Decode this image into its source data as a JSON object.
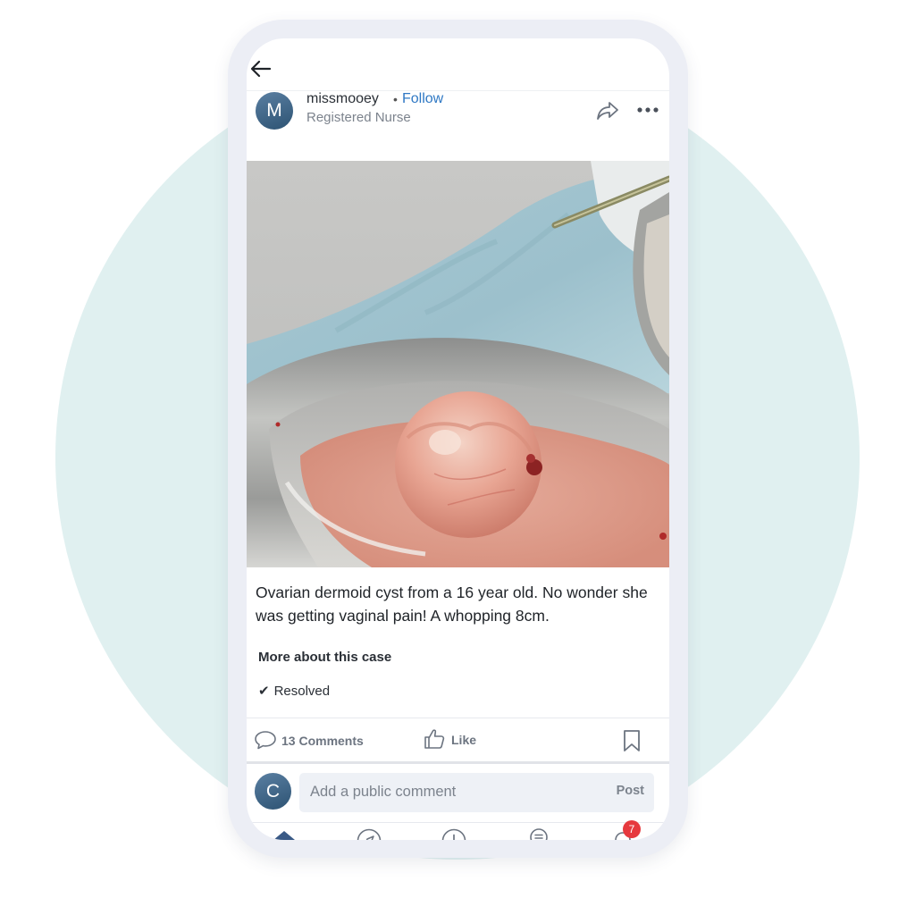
{
  "post": {
    "author": {
      "initial": "M",
      "username": "missmooey",
      "separator": "•",
      "follow_label": "Follow",
      "role": "Registered Nurse"
    },
    "caption": "Ovarian dermoid cyst from a 16 year old. No wonder she was getting vaginal pain! A whopping 8cm.",
    "case_section": {
      "title": "More about this case",
      "status_icon": "✔",
      "status": "Resolved"
    },
    "actions": {
      "comments_label": "13 Comments",
      "like_label": "Like"
    }
  },
  "comment_box": {
    "user_initial": "C",
    "placeholder": "Add a public comment",
    "post_label": "Post"
  },
  "bottom_nav": {
    "items": [
      "home-icon",
      "compass-icon",
      "add-icon",
      "award-icon",
      "bell-icon"
    ],
    "notifications_count": "7"
  },
  "colors": {
    "accent": "#2f78c4",
    "nav_active": "#3a5a86",
    "badge": "#e6393e",
    "background_circle": "#e0f0f0"
  }
}
